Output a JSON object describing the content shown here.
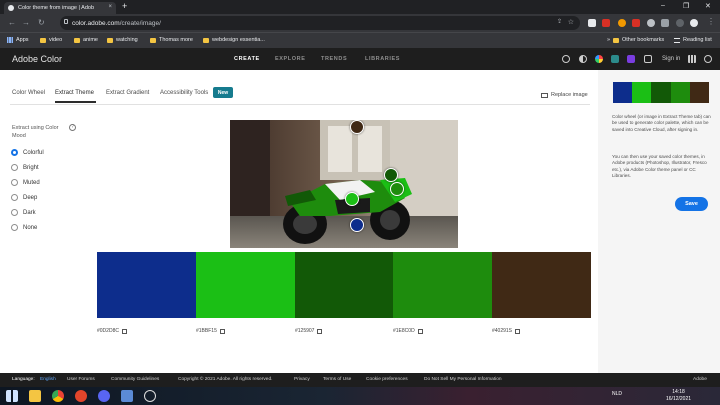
{
  "browser": {
    "tab_title": "Color theme from image | Adob",
    "tab_close": "×",
    "new_tab": "+",
    "url_host": "color.adobe.com",
    "url_path": "/create/image/",
    "window_controls": [
      "–",
      "❐",
      "✕"
    ],
    "bookmarks": [
      {
        "label": "Apps",
        "icon": "apps-grid-icon"
      },
      {
        "label": "video",
        "icon": "folder-icon"
      },
      {
        "label": "anime",
        "icon": "folder-icon"
      },
      {
        "label": "watching",
        "icon": "folder-icon"
      },
      {
        "label": "Thomas more",
        "icon": "folder-icon"
      },
      {
        "label": "webdesign essentia...",
        "icon": "folder-icon"
      }
    ],
    "more_bookmarks": "»",
    "other_bookmarks": "Other bookmarks",
    "reading_list": "Reading list"
  },
  "adobe_header": {
    "brand": "Adobe Color",
    "nav": [
      {
        "label": "CREATE",
        "active": true
      },
      {
        "label": "EXPLORE",
        "active": false
      },
      {
        "label": "TRENDS",
        "active": false
      },
      {
        "label": "LIBRARIES",
        "active": false
      }
    ],
    "sign_in": "Sign in"
  },
  "subnav": {
    "tabs": [
      {
        "label": "Color Wheel",
        "active": false
      },
      {
        "label": "Extract Theme",
        "active": true
      },
      {
        "label": "Extract Gradient",
        "active": false
      },
      {
        "label": "Accessibility Tools",
        "active": false
      }
    ],
    "new_badge": "New",
    "replace_image": "Replace image"
  },
  "mood": {
    "label": "Extract using Color Mood",
    "help": "?",
    "options": [
      "Colorful",
      "Bright",
      "Muted",
      "Deep",
      "Dark",
      "None"
    ],
    "selected": "Colorful"
  },
  "swatches": [
    {
      "hex": "#0D2D8C",
      "color": "#0d2d8c"
    },
    {
      "hex": "#1BBF15",
      "color": "#1bbf15"
    },
    {
      "hex": "#125907",
      "color": "#125907"
    },
    {
      "hex": "#1E8C0D",
      "color": "#1e8c0d"
    },
    {
      "hex": "#40291S",
      "color": "#402915"
    }
  ],
  "sample_dot_colors": [
    "#402915",
    "#125907",
    "#1e8c0d",
    "#1bbf15",
    "#0d2d8c"
  ],
  "right_panel": {
    "description": "Color wheel (or image in Extract Theme tab) can be used to generate color palette, which can be saved into Creative Cloud, after signing in.",
    "description2": "You can then use your saved color themes, in Adobe products (Photoshop, Illustrator, Fresco etc.), via Adobe Color theme panel or CC Libraries.",
    "save_label": "Save"
  },
  "footer": {
    "language_label": "Language:",
    "language_value": "English",
    "links": [
      "User Forums",
      "Community Guidelines",
      "Copyright © 2021 Adobe. All rights reserved.",
      "Privacy",
      "Terms of Use",
      "Cookie preferences",
      "Do Not Sell My Personal Information"
    ],
    "adobe": "Adobe"
  },
  "taskbar": {
    "language": "NLD",
    "time": "14:18",
    "date": "16/12/2021"
  }
}
